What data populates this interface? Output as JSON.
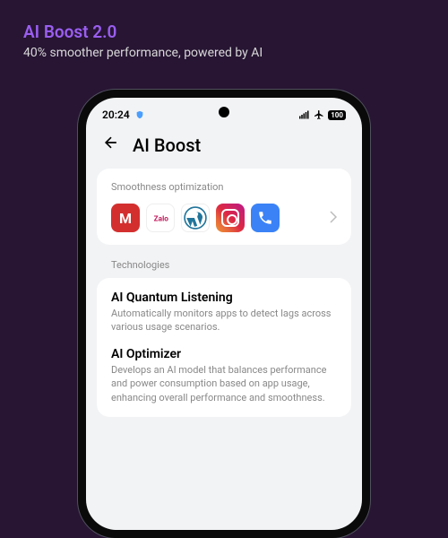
{
  "promo": {
    "title": "AI Boost 2.0",
    "subtitle": "40% smoother performance, powered by AI"
  },
  "statusbar": {
    "time": "20:24",
    "battery": "100"
  },
  "header": {
    "title": "AI Boost"
  },
  "smoothness": {
    "label": "Smoothness optimization",
    "apps": [
      {
        "name": "momo",
        "glyph": "M"
      },
      {
        "name": "zalo",
        "glyph": ""
      },
      {
        "name": "wordpress",
        "glyph": ""
      },
      {
        "name": "instagram",
        "glyph": ""
      },
      {
        "name": "phone",
        "glyph": ""
      }
    ]
  },
  "technologies": {
    "label": "Technologies",
    "items": [
      {
        "title": "AI Quantum Listening",
        "desc": "Automatically monitors apps to detect lags across various usage scenarios."
      },
      {
        "title": "AI Optimizer",
        "desc": "Develops an AI model that balances performance and power consumption based on app usage, enhancing overall performance and smoothness."
      }
    ]
  }
}
